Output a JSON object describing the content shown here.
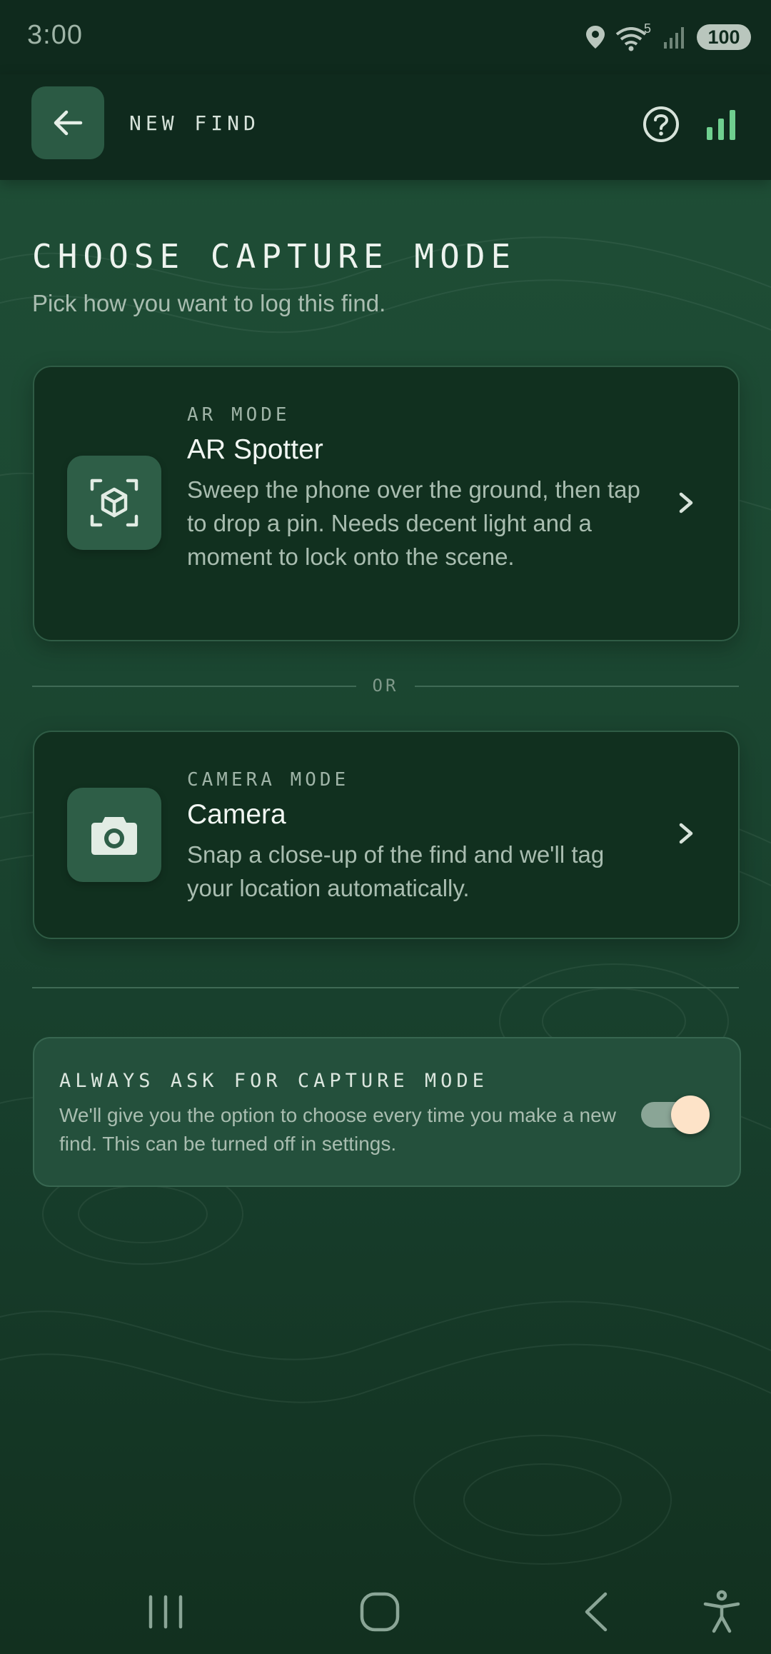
{
  "status_bar": {
    "time": "3:00",
    "wifi_badge": "5",
    "battery": "100"
  },
  "app_bar": {
    "title": "NEW FIND"
  },
  "page": {
    "title": "CHOOSE CAPTURE MODE",
    "subtitle": "Pick how you want to log this find."
  },
  "modes": [
    {
      "kicker": "AR MODE",
      "title": "AR Spotter",
      "description": "Sweep the phone over the ground, then tap to drop a pin. Needs decent light and a moment to lock onto the scene.",
      "icon": "ar-cube-icon"
    },
    {
      "kicker": "CAMERA MODE",
      "title": "Camera",
      "description": "Snap a close-up of the find and we'll tag your location automatically.",
      "icon": "camera-icon"
    }
  ],
  "divider": {
    "label": "OR"
  },
  "setting": {
    "title": "ALWAYS ASK FOR CAPTURE MODE",
    "description": "We'll give you the option to choose every time you make a new find. This can be turned off in settings.",
    "enabled": true
  },
  "colors": {
    "background": "#1c4832",
    "bar": "#0f2a1d",
    "card": "#11301f",
    "accent_green": "#6fcf8f",
    "toggle_knob": "#fde3c8"
  }
}
